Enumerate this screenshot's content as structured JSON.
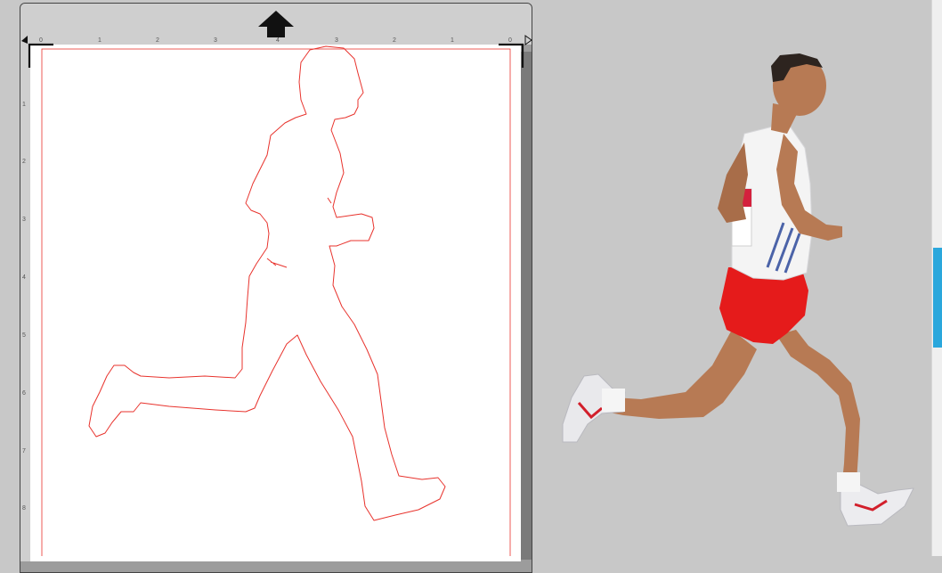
{
  "ruler": {
    "top_ticks": [
      "0",
      "1",
      "2",
      "3",
      "4",
      "3",
      "2",
      "1",
      "0"
    ],
    "left_ticks": [
      "1",
      "2",
      "3",
      "4",
      "5",
      "6",
      "7",
      "8"
    ]
  },
  "colors": {
    "cut_line": "#e8332d",
    "mat_frame": "#9c9c9c",
    "ruler_bg": "#cfcfcf",
    "workspace_bg": "#c8c8c8",
    "accent_tab": "#2aa7dc",
    "runner_shorts": "#e51b1b",
    "runner_skin": "#b77a54",
    "runner_singlet": "#f4f4f4",
    "runner_bib": "#d4213d"
  },
  "icons": {
    "feed": "up-arrow-icon",
    "origin_left": "triangle-left-icon",
    "origin_right": "triangle-right-icon"
  }
}
